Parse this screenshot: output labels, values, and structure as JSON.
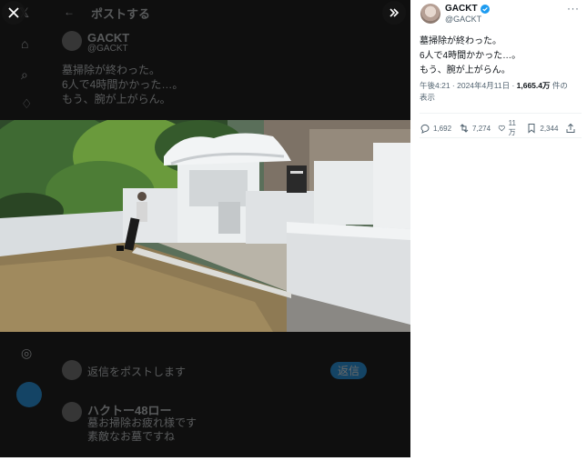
{
  "background": {
    "header_title": "ポストする",
    "author_name": "GACKT",
    "author_handle": "@GACKT",
    "faded_lines": [
      "墓掃除が終わった。",
      "6人で4時間かかった…。",
      "もう、腕が上がらん。"
    ],
    "reply_placeholder": "返信をポストします",
    "reply_button": "返信",
    "reply_author": "ハクトー48ロー",
    "reply_lines": [
      "墓お掃除お疲れ様です",
      "素敵なお墓ですね"
    ]
  },
  "viewer": {
    "close_icon": "close-icon",
    "expand_icon": "chevron-double-right-icon"
  },
  "tweet": {
    "name": "GACKT",
    "handle": "@GACKT",
    "verified_color": "#1d9bf0",
    "lines": [
      "墓掃除が終わった。",
      "6人で4時間かかった…。",
      "もう、腕が上がらん。"
    ],
    "time": "午後4:21",
    "date": "2024年4月11日",
    "views": "1,665.4万",
    "views_suffix": "件の",
    "views_label": "表示",
    "replies": "1,692",
    "reposts": "7,274",
    "likes": "11万",
    "bookmarks": "2,344"
  }
}
